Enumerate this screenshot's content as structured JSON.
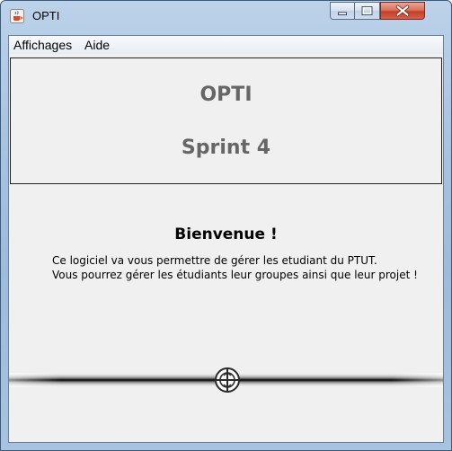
{
  "window": {
    "title": "OPTI",
    "icon": "java-coffee-cup-icon"
  },
  "controls": {
    "minimize_icon": "minimize-icon",
    "maximize_icon": "maximize-icon",
    "close_icon": "close-icon"
  },
  "menubar": {
    "items": [
      {
        "label": "Affichages"
      },
      {
        "label": "Aide"
      }
    ]
  },
  "header": {
    "title": "OPTI",
    "subtitle": "Sprint 4",
    "text_color": "#666666"
  },
  "welcome": {
    "title": "Bienvenue !",
    "lines": [
      "Ce logiciel va vous permettre de gérer les etudiant du PTUT.",
      "Vous pourrez gérer les étudiants leur groupes ainsi que leur projet !"
    ]
  },
  "splitter": {
    "handle_icon": "splitter-drag-handle-icon"
  },
  "colors": {
    "window_frame": "#a9c4e1",
    "client_background": "#f0f0f0",
    "close_button": "#c33f26"
  }
}
